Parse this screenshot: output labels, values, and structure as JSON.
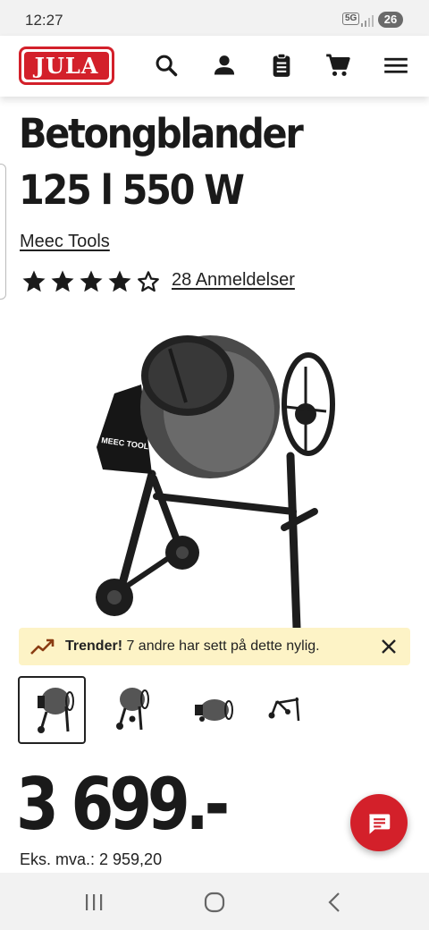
{
  "status_bar": {
    "time": "12:27",
    "network": "5G",
    "battery": "26"
  },
  "header": {
    "logo_text": "JULA"
  },
  "product": {
    "title": "Betongblander 125 l 550 W",
    "brand": "Meec Tools",
    "rating": 4,
    "rating_max": 5,
    "reviews_label": "28 Anmeldelser",
    "image_brand_text": "MEEC TOOLS"
  },
  "trend_banner": {
    "title": "Trender!",
    "text": " 7 andre har sett på dette nylig."
  },
  "thumbnails": {
    "count": 4,
    "selected_index": 0
  },
  "price": {
    "main": "3 699.-",
    "ex_vat": "Eks. mva.: 2 959,20"
  },
  "colors": {
    "brand_red": "#d3202a",
    "banner_bg": "#fdf3c6",
    "text": "#1a1a1a"
  }
}
